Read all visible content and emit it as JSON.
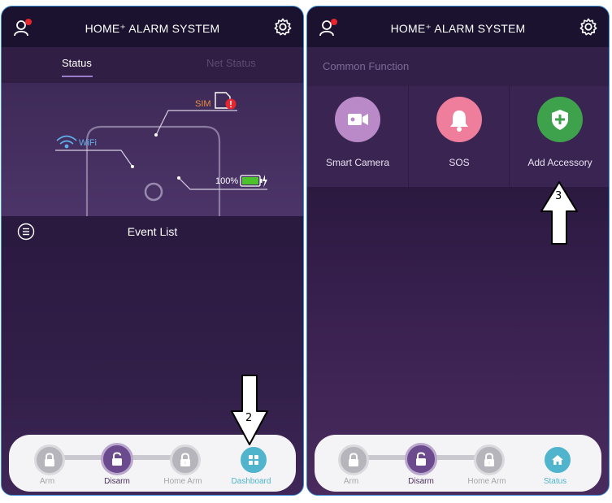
{
  "left_screen": {
    "title": "HOME⁺ ALARM SYSTEM",
    "tabs": [
      {
        "label": "Status",
        "active": true
      },
      {
        "label": "Net Status",
        "active": false
      }
    ],
    "device_status": {
      "wifi_label": "WiFi",
      "sim_label": "SIM",
      "battery_label": "100%"
    },
    "event_list_label": "Event List",
    "nav": [
      {
        "label": "Arm",
        "icon": "lock-icon",
        "state": "inactive"
      },
      {
        "label": "Disarm",
        "icon": "unlock-icon",
        "state": "active"
      },
      {
        "label": "Home Arm",
        "icon": "home-arm-lock-icon",
        "state": "inactive"
      },
      {
        "label": "Dashboard",
        "icon": "dashboard-icon",
        "state": "highlight"
      }
    ]
  },
  "right_screen": {
    "title": "HOME⁺ ALARM SYSTEM",
    "common_function_label": "Common Function",
    "functions": [
      {
        "label": "Smart Camera",
        "icon": "camera-icon",
        "color": "#b98ac7"
      },
      {
        "label": "SOS",
        "icon": "bell-icon",
        "color": "#ef7d9c"
      },
      {
        "label": "Add Accessory",
        "icon": "shield-plus-icon",
        "color": "#3ea24c"
      }
    ],
    "nav": [
      {
        "label": "Arm",
        "icon": "lock-icon",
        "state": "inactive"
      },
      {
        "label": "Disarm",
        "icon": "unlock-icon",
        "state": "active"
      },
      {
        "label": "Home Arm",
        "icon": "home-arm-lock-icon",
        "state": "inactive"
      },
      {
        "label": "Status",
        "icon": "home-icon",
        "state": "highlight"
      }
    ]
  },
  "annotations": {
    "step2": "2",
    "step3": "3"
  },
  "colors": {
    "accent_teal": "#4fb4cc",
    "notification_red": "#e8252c",
    "sim_orange": "#e98b3a",
    "battery_green": "#4ec12f",
    "wifi_blue": "#5fb0e8"
  }
}
